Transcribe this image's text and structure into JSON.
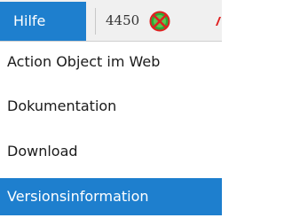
{
  "menubar": {
    "menu_title": "Hilfe",
    "counter": "4450",
    "status_icon": "green-circle-red-x-icon"
  },
  "menu": {
    "items": [
      {
        "label": "Action Object im Web"
      },
      {
        "label": "Dokumentation"
      },
      {
        "label": "Download"
      },
      {
        "label": "Versionsinformation",
        "active": true
      }
    ]
  },
  "colors": {
    "accent": "#1e7fce",
    "menubar_bg": "#f0f0f0",
    "icon_green": "#2ea836",
    "icon_red": "#e02020"
  }
}
